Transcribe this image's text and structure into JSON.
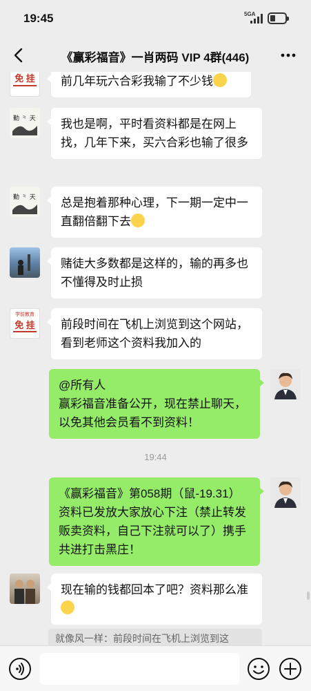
{
  "status": {
    "time": "19:45",
    "network": "5GA"
  },
  "header": {
    "title": "《赢彩福音》一肖两码 VIP 4群(446)"
  },
  "messages": [
    {
      "side": "left",
      "avatar_badge": "免 挂",
      "text": "前几年玩六合彩我输了不少钱"
    },
    {
      "side": "left",
      "avatar_badge": "",
      "text": "我也是啊，平时看资料都是在网上找，几年下来，买六合彩也输了很多"
    },
    {
      "side": "left",
      "avatar_badge": "",
      "text": "总是抱着那种心理，下一期一定中一直翻倍翻下去"
    },
    {
      "side": "left",
      "avatar_badge": "",
      "text": "赌徒大多数都是这样的，输的再多也不懂得及时止损"
    },
    {
      "side": "left",
      "avatar_top": "学前教育",
      "avatar_badge": "免 挂",
      "text": "前段时间在飞机上浏览到这个网站，看到老师这个资料我加入的"
    },
    {
      "side": "right",
      "text_line1": "@所有人",
      "text": "赢彩福音准备公开，现在禁止聊天，以免其他会员看不到资料！"
    },
    {
      "side": "right",
      "text": "《赢彩福音》第058期（鼠-19.31）资料已发放大家放心下注（禁止转发贩卖资料，自己下注就可以了）携手共进打击黑庄！"
    },
    {
      "side": "left",
      "text": "现在输的钱都回本了吧？资料那么准"
    }
  ],
  "timestamp": "19:44",
  "quote_preview": "就像风一样：前段时间在飞机上浏览到这",
  "icons": {
    "back": "chevron-left-icon",
    "more": "more-dots-icon",
    "voice": "voice-icon",
    "emoji": "smile-icon",
    "add": "plus-icon"
  },
  "colors": {
    "bg": "#ededed",
    "own_bubble": "#95ec69",
    "other_bubble": "#ffffff"
  }
}
